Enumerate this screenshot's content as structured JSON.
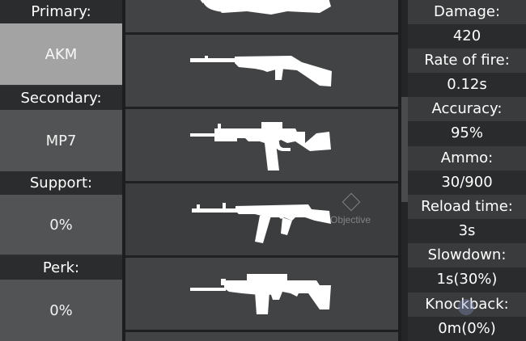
{
  "loadout": {
    "primary_label": "Primary:",
    "primary_value": "AKM",
    "secondary_label": "Secondary:",
    "secondary_value": "MP7",
    "support_label": "Support:",
    "support_value": "0%",
    "perk_label": "Perk:",
    "perk_value": "0%"
  },
  "weapons": [
    {
      "icon": "shotgun-icon"
    },
    {
      "icon": "m1-carbine-icon"
    },
    {
      "icon": "m4a1-icon"
    },
    {
      "icon": "akm-icon",
      "selected": true
    },
    {
      "icon": "scar-icon"
    }
  ],
  "objective": {
    "label": "Objective",
    "icon": "diamond-icon"
  },
  "stats": {
    "damage_label": "Damage:",
    "damage_value": "420",
    "rate_label": "Rate of fire:",
    "rate_value": "0.12s",
    "accuracy_label": "Accuracy:",
    "accuracy_value": "95%",
    "ammo_label": "Ammo:",
    "ammo_value": "30/900",
    "reload_label": "Reload time:",
    "reload_value": "3s",
    "slowdown_label": "Slowdown:",
    "slowdown_value": "1s(30%)",
    "knockback_label": "Knockback:",
    "knockback_value": "0m(0%)"
  },
  "colors": {
    "selected_slot": "#a3a3a3",
    "slot": "#525354",
    "panel": "#2b2c2d",
    "weapon_fill": "#ffffff"
  }
}
